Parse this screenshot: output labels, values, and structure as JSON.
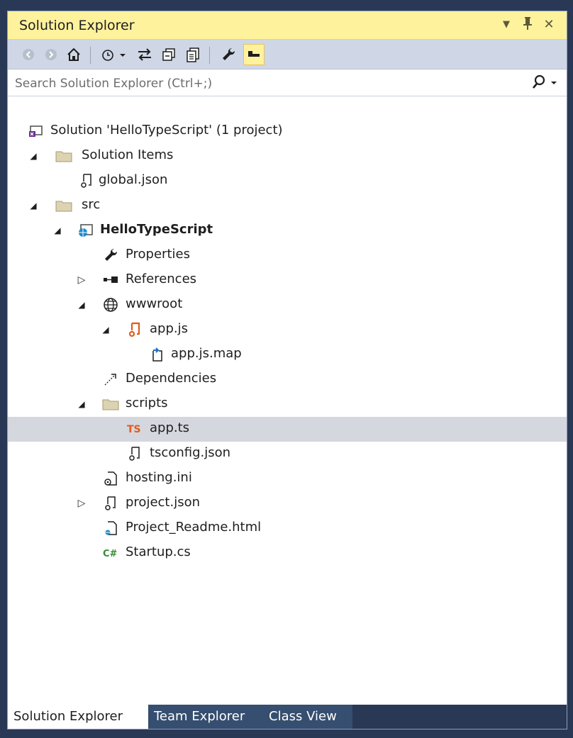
{
  "window": {
    "title": "Solution Explorer",
    "dropdown_icon": "chevron-down-icon",
    "pin_icon": "pin-icon",
    "close_icon": "close-icon"
  },
  "toolbar": {
    "items": [
      "back-icon",
      "forward-icon",
      "home-icon",
      "pending-changes-icon",
      "sync-icon",
      "collapse-all-icon",
      "show-all-files-icon",
      "properties-icon",
      "preview-icon"
    ]
  },
  "search": {
    "placeholder": "Search Solution Explorer (Ctrl+;)"
  },
  "tree": [
    {
      "label": "Solution 'HelloTypeScript' (1 project)",
      "icon": "solution-icon"
    },
    {
      "label": "Solution Items",
      "icon": "folder-icon",
      "expanded": true
    },
    {
      "label": "global.json",
      "icon": "json-file-icon"
    },
    {
      "label": "src",
      "icon": "folder-icon",
      "expanded": true
    },
    {
      "label": "HelloTypeScript",
      "icon": "web-project-icon",
      "expanded": true
    },
    {
      "label": "Properties",
      "icon": "wrench-icon"
    },
    {
      "label": "References",
      "icon": "references-icon",
      "expanded": false
    },
    {
      "label": "wwwroot",
      "icon": "globe-icon",
      "expanded": true
    },
    {
      "label": "app.js",
      "icon": "js-file-icon",
      "expanded": true
    },
    {
      "label": "app.js.map",
      "icon": "map-file-icon"
    },
    {
      "label": "Dependencies",
      "icon": "dependencies-icon"
    },
    {
      "label": "scripts",
      "icon": "folder-icon",
      "expanded": true
    },
    {
      "label": "app.ts",
      "icon": "typescript-icon",
      "selected": true
    },
    {
      "label": "tsconfig.json",
      "icon": "json-file-icon"
    },
    {
      "label": "hosting.ini",
      "icon": "config-file-icon"
    },
    {
      "label": "project.json",
      "icon": "json-file-icon",
      "expanded": false
    },
    {
      "label": "Project_Readme.html",
      "icon": "html-file-icon"
    },
    {
      "label": "Startup.cs",
      "icon": "csharp-icon"
    }
  ],
  "tabs": [
    {
      "label": "Solution Explorer",
      "active": true
    },
    {
      "label": "Team Explorer",
      "active": false
    },
    {
      "label": "Class View",
      "active": false
    }
  ],
  "colors": {
    "title_bar": "#fff29d",
    "toolbar": "#cfd6e5",
    "frame": "#293955",
    "selected_row": "#d5d7de",
    "inactive_tab": "#364e6f"
  }
}
